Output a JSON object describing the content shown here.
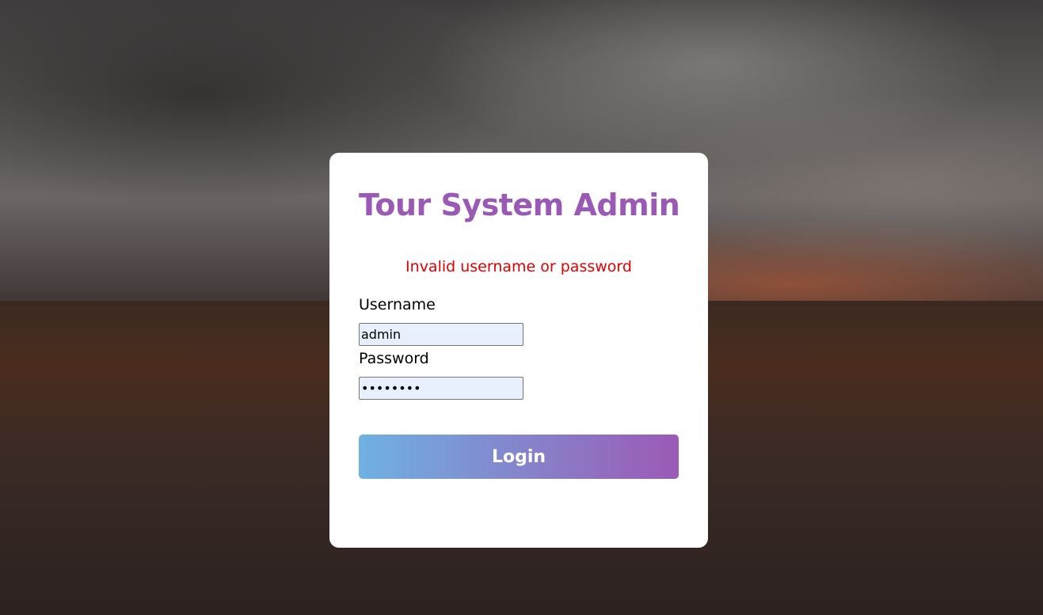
{
  "page": {
    "title": "Tour System Admin",
    "error_message": "Invalid username or password"
  },
  "form": {
    "username_label": "Username",
    "username_value": "admin",
    "password_label": "Password",
    "password_value": "password",
    "login_label": "Login"
  },
  "colors": {
    "title": "#9b59b6",
    "error": "#e00000",
    "button_gradient_start": "#6fb1e2",
    "button_gradient_end": "#9b59b6",
    "input_background": "#e8f0fe"
  }
}
